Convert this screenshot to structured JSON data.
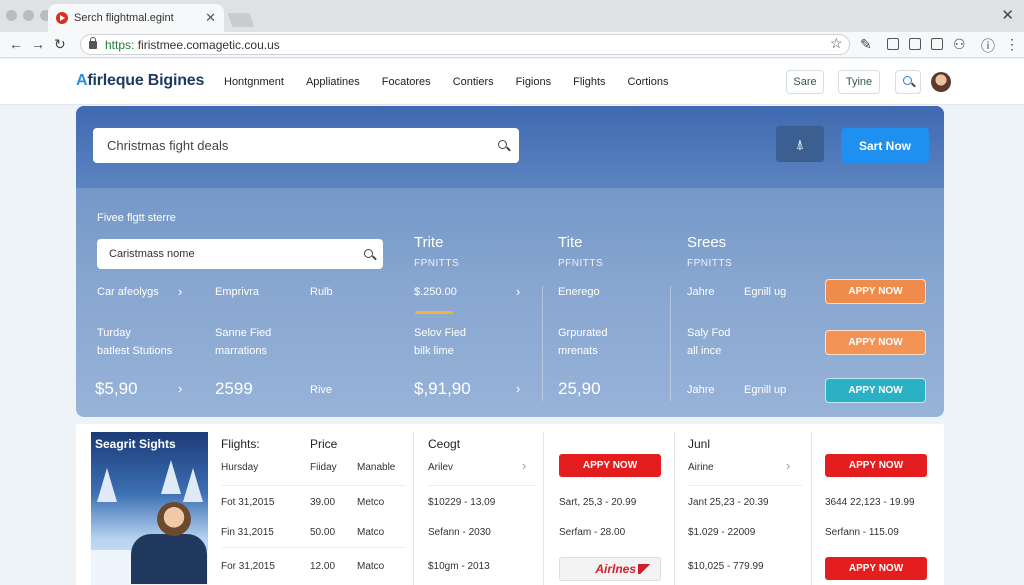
{
  "browser": {
    "tab_title": "Serch flightmal.egint",
    "close_glyph": "✕",
    "url_scheme": "https:",
    "url_rest": " firistmee.comagetic.cou.us"
  },
  "header": {
    "logo_prefix": "A",
    "logo_rest": "firleque Bigines",
    "nav": [
      "Hontgnment",
      "Appliatines",
      "Focatores",
      "Contiers",
      "Figions",
      "Flights",
      "Cortions"
    ],
    "btn_save": "Sare",
    "btn_tyine": "Tyine"
  },
  "hero": {
    "search_placeholder": "Christmas fight deals",
    "start_label": "Sart Now",
    "section_label": "Fivee flgtt sterre",
    "sub_search": "Caristmass nome",
    "row1": {
      "c1": "Car afeolygs",
      "c2": "Emprivra",
      "c3": "Rulb",
      "c4": "$.250.00",
      "c5": "Enerego",
      "c6a": "Jahre",
      "c6b": "Egnill ug"
    },
    "columns": [
      {
        "title": "Trite",
        "sub": "FPNITTS"
      },
      {
        "title": "Tite",
        "sub": "PFNITTS"
      },
      {
        "title": "Srees",
        "sub": "FPNITTS"
      }
    ],
    "row2": {
      "c1a": "Turday",
      "c1b": "batlest Stutions",
      "c2a": "Sanne Fied",
      "c2b": "marrations",
      "c4a": "Selov Fied",
      "c4b": "bilk lime",
      "c5a": "Grpurated",
      "c5b": "mrenats",
      "c6a": "Saly Fod",
      "c6b": "all ince"
    },
    "row3": {
      "c1": "$5,90",
      "c2": "2599",
      "c3": "Rive",
      "c4": "$,91,90",
      "c5": "25,90",
      "c6a": "Jahre",
      "c6b": "Egnill up"
    },
    "apply_label": "APPY NOW",
    "apply_colors": [
      "#f08c4b",
      "#f39355",
      "#2ab1c4"
    ]
  },
  "results": {
    "promo_title": "Seagrit Sights",
    "headers": {
      "flights": "Flights:",
      "price": "Price",
      "ceogt": "Ceogt",
      "junl": "Junl"
    },
    "col1_rows": [
      "Hursday",
      "Fot 31,2015",
      "Fin 31,2015",
      "For 31,2015"
    ],
    "col2_rows": [
      "Fiiday",
      "39.00",
      "50.00",
      "12.00"
    ],
    "col3_rows": [
      "Manable",
      "Metco",
      "Matco",
      "Matco"
    ],
    "col4_rows": [
      "Arilev",
      "$10229 - 13.09",
      "Sefann - 2030",
      "$10gm - 2013"
    ],
    "col5_rows": [
      "Sart, 25,3 - 20.99",
      "Serfam - 28.00"
    ],
    "col6_rows": [
      "Airine",
      "Jant 25,23 - 20.39",
      "$1.029 - 22009",
      "$10,025 - 779.99"
    ],
    "col7_rows": [
      "3644 22,123 - 19.99",
      "Serfann - 115.09"
    ],
    "red_label": "APPY NOW",
    "airline_text": "Airlnes"
  }
}
